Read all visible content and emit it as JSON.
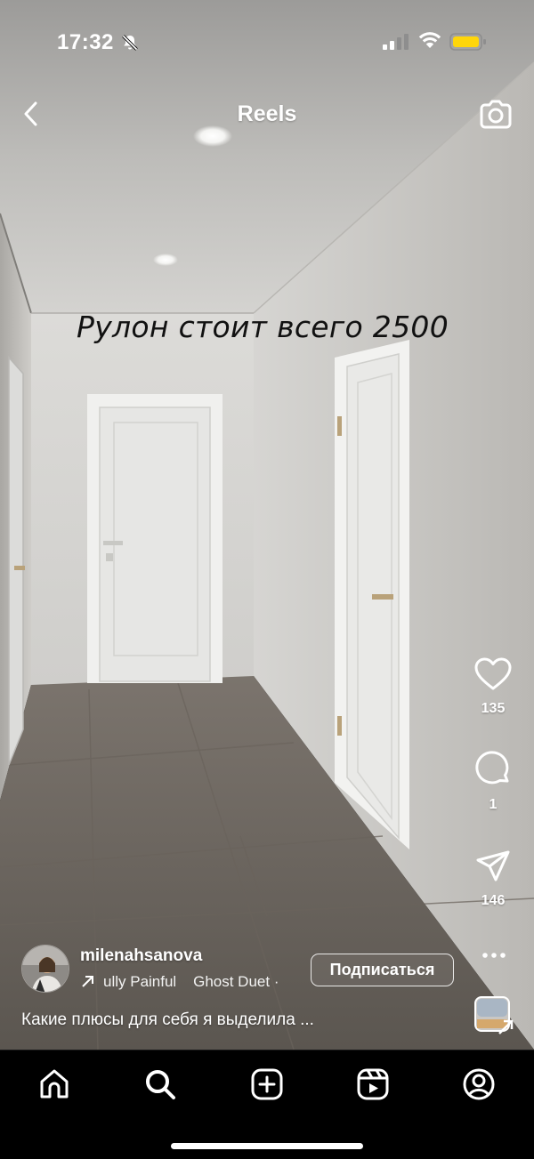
{
  "status_bar": {
    "time": "17:32",
    "icons": [
      "bell-slash-icon",
      "cellular-signal-icon",
      "wifi-icon",
      "battery-icon"
    ],
    "battery_color": "#ffd60a"
  },
  "header": {
    "title": "Reels",
    "back_icon": "chevron-left-icon",
    "camera_icon": "camera-icon"
  },
  "video": {
    "overlay_text": "Рулон стоит всего 2500"
  },
  "actions": {
    "likes": "135",
    "comments": "1",
    "shares": "146",
    "icons": [
      "heart-icon",
      "comment-icon",
      "send-icon",
      "more-icon"
    ]
  },
  "author": {
    "username": "milenahsanova",
    "audio": "ully Painful    Ghost Duet ·",
    "follow_label": "Подписаться",
    "caption": "Какие плюсы для себя я выделила ..."
  },
  "nav": {
    "items": [
      "home-icon",
      "search-icon",
      "create-icon",
      "reels-icon",
      "profile-icon"
    ]
  }
}
